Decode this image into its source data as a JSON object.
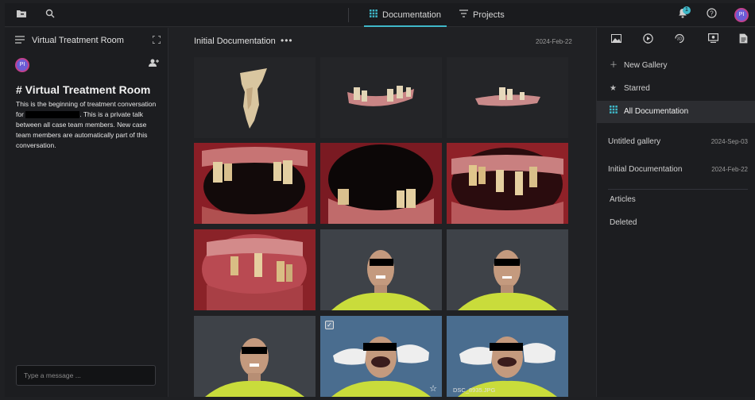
{
  "topbar": {
    "tabs": [
      {
        "label": "Documentation",
        "icon": "grid-icon"
      },
      {
        "label": "Projects",
        "icon": "filter-icon"
      }
    ],
    "notification_count": "1",
    "user_initials": "PI"
  },
  "chat": {
    "title": "Virtual Treatment Room",
    "avatar_initials": "PI",
    "heading": "# Virtual Treatment Room",
    "body_part1": "This is the beginning of treatment conversation for ",
    "body_part2": ". This is a private talk between all case team members. New case team members are automatically part of this conversation.",
    "input_placeholder": "Type a message ..."
  },
  "main": {
    "gallery_title": "Initial Documentation",
    "gallery_date": "2024-Feb-22",
    "tiles": [
      {
        "kind": "scan-single"
      },
      {
        "kind": "scan-arch"
      },
      {
        "kind": "scan-arch-small"
      },
      {
        "kind": "intraoral-gap"
      },
      {
        "kind": "intraoral-dark"
      },
      {
        "kind": "intraoral-wide"
      },
      {
        "kind": "intraoral-lower"
      },
      {
        "kind": "portrait"
      },
      {
        "kind": "portrait"
      },
      {
        "kind": "portrait"
      },
      {
        "kind": "portrait-retractor",
        "checked": true
      },
      {
        "kind": "portrait-retractor",
        "caption": "DSC_8935.JPG"
      }
    ],
    "last_caption": "DSC_8935.JPG"
  },
  "sidebar": {
    "tools": [
      "image-icon",
      "play-icon",
      "3d-icon",
      "presentation-icon",
      "document-icon"
    ],
    "new_gallery": "New Gallery",
    "starred": "Starred",
    "all_documentation": "All Documentation",
    "galleries": [
      {
        "name": "Untitled gallery",
        "date": "2024-Sep-03"
      },
      {
        "name": "Initial Documentation",
        "date": "2024-Feb-22"
      }
    ],
    "articles": "Articles",
    "deleted": "Deleted"
  },
  "colors": {
    "accent": "#3fb8c9",
    "background": "#202124",
    "panel": "#1c1d20"
  }
}
